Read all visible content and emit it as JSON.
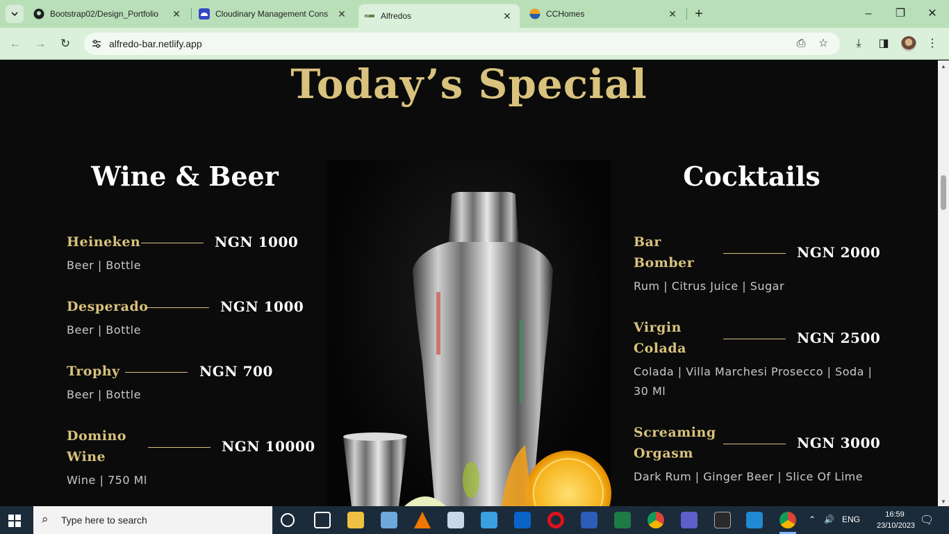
{
  "browser": {
    "tabs": [
      {
        "title": "Bootstrap02/Design_Portfolio",
        "icon": "github-icon"
      },
      {
        "title": "Cloudinary Management Cons",
        "icon": "cloudinary-icon"
      },
      {
        "title": "Alfredos",
        "icon": "alfredos-favicon",
        "active": true
      },
      {
        "title": "CCHomes",
        "icon": "cchomes-icon"
      }
    ],
    "url": "alfredo-bar.netlify.app"
  },
  "page": {
    "special_title": "Today’s Special",
    "wine_beer": {
      "title": "Wine & Beer",
      "items": [
        {
          "name": "Heineken",
          "price": "NGN 1000",
          "desc": "Beer | Bottle"
        },
        {
          "name": "Desperado",
          "price": "NGN 1000",
          "desc": "Beer | Bottle"
        },
        {
          "name": "Trophy",
          "price": "NGN 700",
          "desc": "Beer | Bottle"
        },
        {
          "name_lines": [
            "Domino",
            "Wine"
          ],
          "price": "NGN 10000",
          "desc": "Wine | 750 Ml"
        }
      ]
    },
    "cocktails": {
      "title": "Cocktails",
      "items": [
        {
          "name_lines": [
            "Bar",
            "Bomber"
          ],
          "price": "NGN 2000",
          "desc": "Rum | Citrus Juice | Sugar"
        },
        {
          "name_lines": [
            "Virgin",
            "Colada"
          ],
          "price": "NGN 2500",
          "desc_lines": [
            "Colada | Villa Marchesi Prosecco | Soda |",
            "30 Ml"
          ]
        },
        {
          "name_lines": [
            "Screaming",
            "Orgasm"
          ],
          "price": "NGN 3000",
          "desc": "Dark Rum | Ginger Beer | Slice Of Lime"
        }
      ]
    },
    "accent_color": "#d8c27d"
  },
  "taskbar": {
    "search_placeholder": "Type here to search",
    "language": "ENG",
    "time": "16:59",
    "date": "23/10/2023"
  }
}
